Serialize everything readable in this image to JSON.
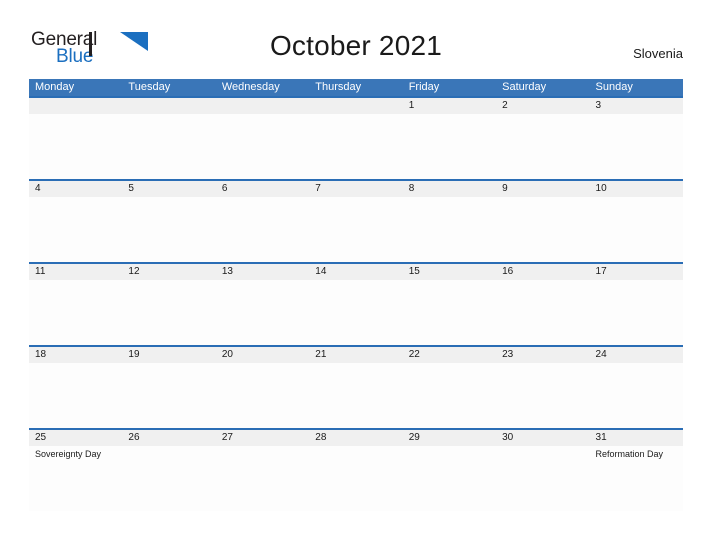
{
  "brand": {
    "name_part1": "General",
    "name_part2": "Blue",
    "flag_icon": "flag-icon",
    "accent_color": "#1b6fc0"
  },
  "header": {
    "title": "October 2021",
    "locale": "Slovenia"
  },
  "theme": {
    "header_row_color": "#3a76b8",
    "row_rule_color": "#2a6db5",
    "date_band_color": "#f0f0f0",
    "text_color": "#1a1a1a"
  },
  "calendar": {
    "weekdays": [
      "Monday",
      "Tuesday",
      "Wednesday",
      "Thursday",
      "Friday",
      "Saturday",
      "Sunday"
    ],
    "weeks": [
      {
        "days": [
          {
            "date": "",
            "event": ""
          },
          {
            "date": "",
            "event": ""
          },
          {
            "date": "",
            "event": ""
          },
          {
            "date": "",
            "event": ""
          },
          {
            "date": "1",
            "event": ""
          },
          {
            "date": "2",
            "event": ""
          },
          {
            "date": "3",
            "event": ""
          }
        ]
      },
      {
        "days": [
          {
            "date": "4",
            "event": ""
          },
          {
            "date": "5",
            "event": ""
          },
          {
            "date": "6",
            "event": ""
          },
          {
            "date": "7",
            "event": ""
          },
          {
            "date": "8",
            "event": ""
          },
          {
            "date": "9",
            "event": ""
          },
          {
            "date": "10",
            "event": ""
          }
        ]
      },
      {
        "days": [
          {
            "date": "11",
            "event": ""
          },
          {
            "date": "12",
            "event": ""
          },
          {
            "date": "13",
            "event": ""
          },
          {
            "date": "14",
            "event": ""
          },
          {
            "date": "15",
            "event": ""
          },
          {
            "date": "16",
            "event": ""
          },
          {
            "date": "17",
            "event": ""
          }
        ]
      },
      {
        "days": [
          {
            "date": "18",
            "event": ""
          },
          {
            "date": "19",
            "event": ""
          },
          {
            "date": "20",
            "event": ""
          },
          {
            "date": "21",
            "event": ""
          },
          {
            "date": "22",
            "event": ""
          },
          {
            "date": "23",
            "event": ""
          },
          {
            "date": "24",
            "event": ""
          }
        ]
      },
      {
        "days": [
          {
            "date": "25",
            "event": "Sovereignty Day"
          },
          {
            "date": "26",
            "event": ""
          },
          {
            "date": "27",
            "event": ""
          },
          {
            "date": "28",
            "event": ""
          },
          {
            "date": "29",
            "event": ""
          },
          {
            "date": "30",
            "event": ""
          },
          {
            "date": "31",
            "event": "Reformation Day"
          }
        ]
      }
    ]
  }
}
